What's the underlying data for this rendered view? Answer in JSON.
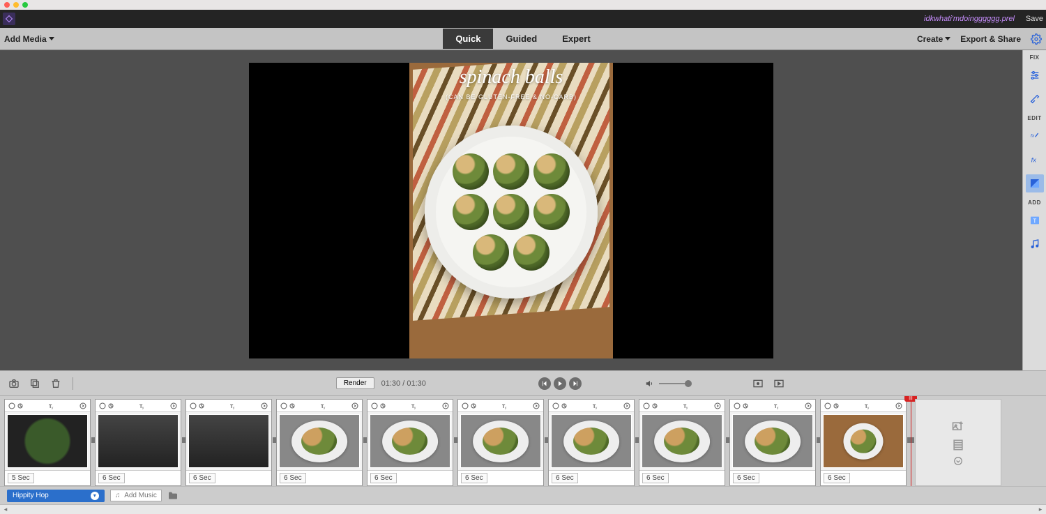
{
  "titlebar": {},
  "appbar": {
    "project_name": "idkwhati'mdoingggggg.prel",
    "save_label": "Save"
  },
  "modebar": {
    "add_media": "Add Media",
    "tabs": {
      "quick": "Quick",
      "guided": "Guided",
      "expert": "Expert"
    },
    "active_tab": "quick",
    "create": "Create",
    "export_share": "Export & Share"
  },
  "preview": {
    "title": "spinach balls",
    "subtitle": "(CAN BE GLUTEN-FREE & NO-CARB)"
  },
  "rail": {
    "fix_header": "FIX",
    "edit_header": "EDIT",
    "add_header": "ADD"
  },
  "controls": {
    "render": "Render",
    "time_current": "01:30",
    "time_total": "01:30",
    "time_sep": "/"
  },
  "timeline": {
    "clips": [
      {
        "duration": "5 Sec",
        "variant": "pan"
      },
      {
        "duration": "6 Sec",
        "variant": "tray"
      },
      {
        "duration": "6 Sec",
        "variant": "tray"
      },
      {
        "duration": "6 Sec",
        "variant": "plate"
      },
      {
        "duration": "6 Sec",
        "variant": "plate"
      },
      {
        "duration": "6 Sec",
        "variant": "plate"
      },
      {
        "duration": "6 Sec",
        "variant": "plate"
      },
      {
        "duration": "6 Sec",
        "variant": "plate"
      },
      {
        "duration": "6 Sec",
        "variant": "plate"
      },
      {
        "duration": "6 Sec",
        "variant": "vert"
      }
    ]
  },
  "audiobar": {
    "sound_name": "Hippity Hop",
    "add_music_label": "Add Music"
  }
}
